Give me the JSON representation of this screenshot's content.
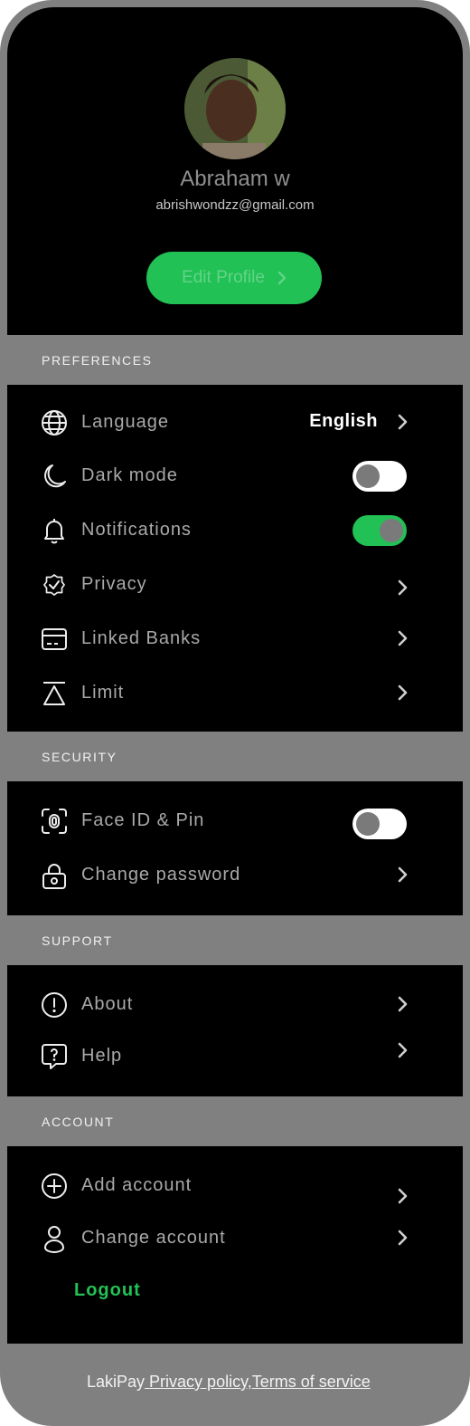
{
  "profile": {
    "name": "Abraham w",
    "email": "abrishwondzz@gmail.com",
    "edit_label": "Edit Profile"
  },
  "sections": {
    "preferences": "PREFERENCES",
    "security": "SECURITY",
    "support": "SUPPORT",
    "account": "ACCOUNT"
  },
  "preferences": {
    "language": {
      "label": "Language",
      "value": "English",
      "icon": "globe-icon"
    },
    "dark_mode": {
      "label": "Dark mode",
      "icon": "moon-icon",
      "enabled": false
    },
    "notifications": {
      "label": "Notifications",
      "icon": "bell-icon",
      "enabled": true
    },
    "privacy": {
      "label": "Privacy",
      "icon": "shield-check-icon"
    },
    "linked_banks": {
      "label": "Linked Banks",
      "icon": "credit-card-icon"
    },
    "limit": {
      "label": "Limit",
      "icon": "limit-icon"
    }
  },
  "security": {
    "face_id": {
      "label": "Face ID & Pin",
      "icon": "face-id-icon",
      "enabled": false
    },
    "change_password": {
      "label": "Change password",
      "icon": "lock-icon"
    }
  },
  "support": {
    "about": {
      "label": "About",
      "icon": "info-icon"
    },
    "help": {
      "label": "Help",
      "icon": "help-bubble-icon"
    }
  },
  "account": {
    "add_account": {
      "label": "Add account",
      "icon": "plus-circle-icon"
    },
    "change_account": {
      "label": "Change account",
      "icon": "user-icon"
    },
    "logout_label": "Logout"
  },
  "footer": {
    "brand": "LakiPay",
    "privacy_link": " Privacy policy,",
    "terms_link": "Terms of service"
  },
  "colors": {
    "accent": "#22c155",
    "background": "#000000",
    "section_bg": "#808080"
  }
}
